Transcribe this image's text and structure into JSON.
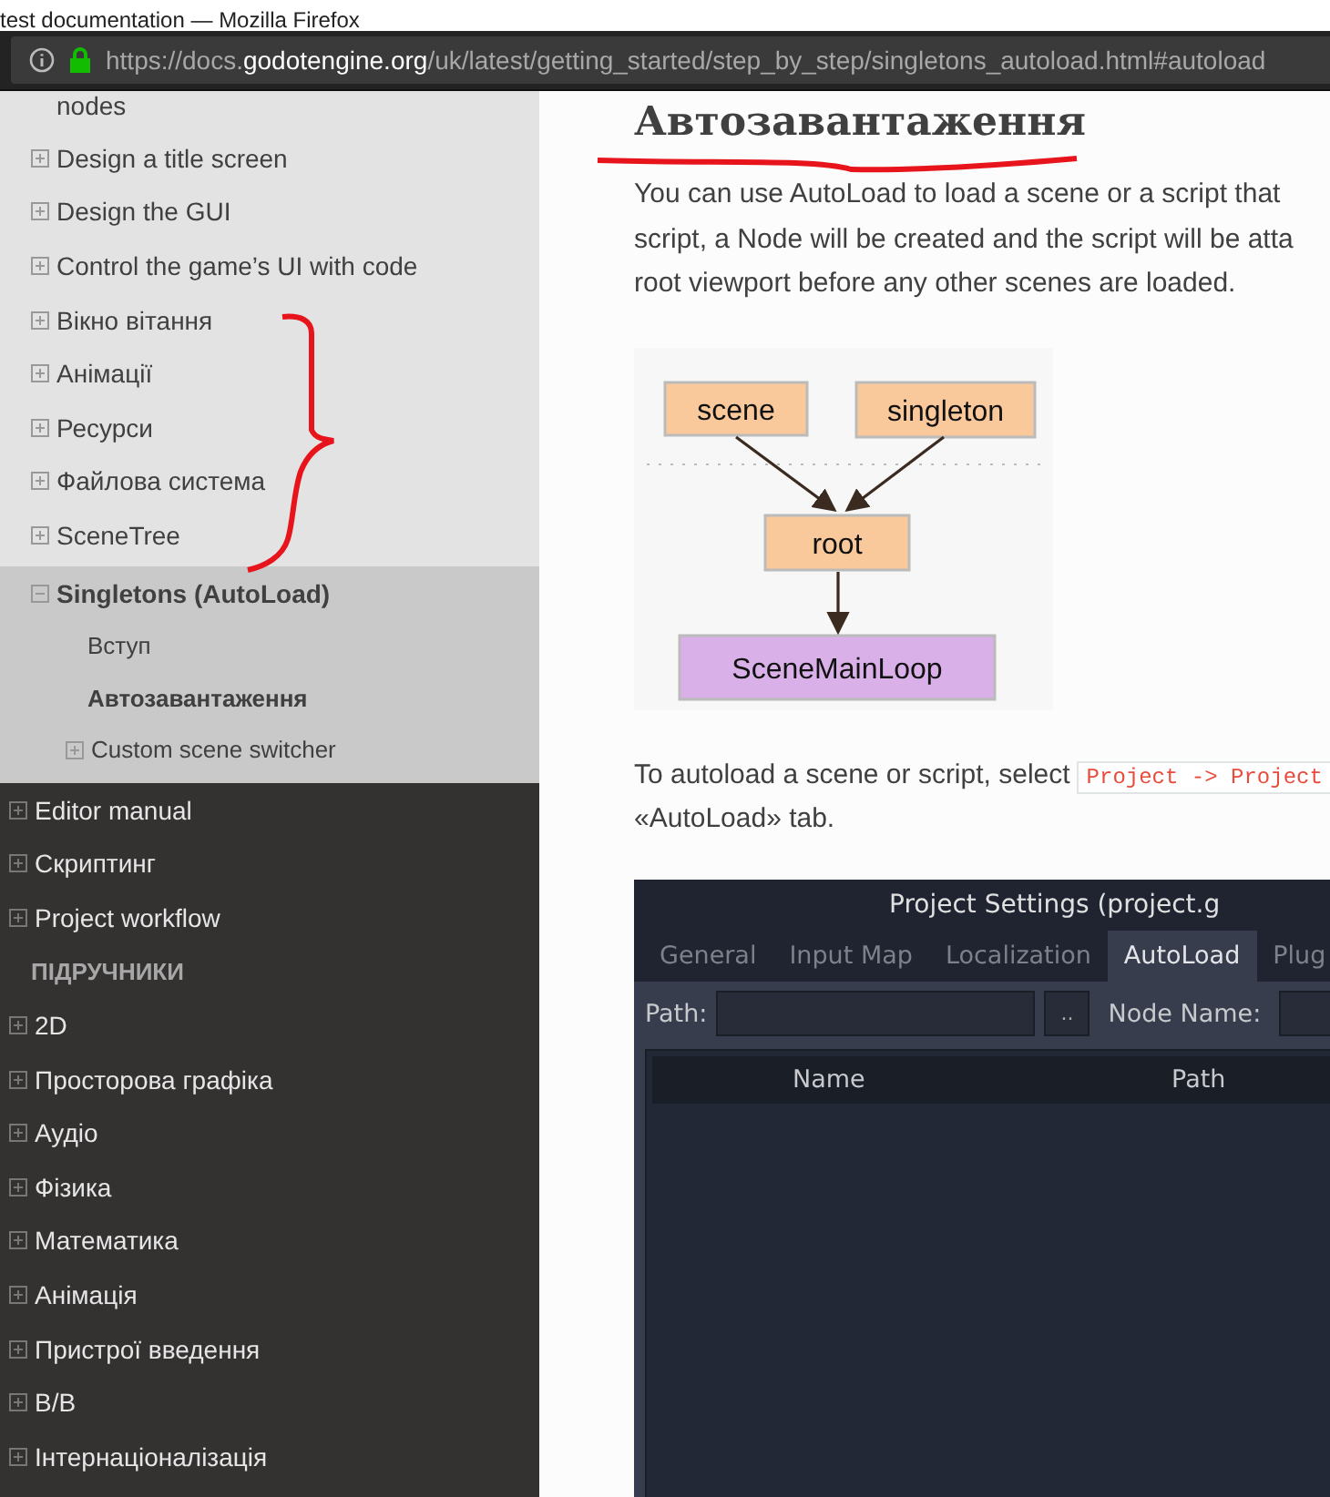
{
  "browser": {
    "window_title": "test documentation — Mozilla Firefox",
    "url": "https://docs.**godotengine.org**/uk/latest/getting_started/step_by_step/singletons_autoload.html#autoload"
  },
  "sidebar": {
    "nested_items": [
      {
        "label": "nodes",
        "kind": "continuation"
      },
      {
        "label": "Design a title screen",
        "kind": "collapsed"
      },
      {
        "label": "Design the GUI",
        "kind": "collapsed"
      },
      {
        "label": "Control the game’s UI with code",
        "kind": "collapsed"
      },
      {
        "label": "Вікно вітання",
        "kind": "collapsed"
      },
      {
        "label": "Анімації",
        "kind": "collapsed"
      },
      {
        "label": "Ресурси",
        "kind": "collapsed"
      },
      {
        "label": "Файлова система",
        "kind": "collapsed"
      },
      {
        "label": "SceneTree",
        "kind": "collapsed"
      }
    ],
    "current_item": {
      "label": "Singletons (AutoLoad)",
      "expanded": true,
      "children": [
        {
          "label": "Вступ",
          "kind": "leaf",
          "selected": false
        },
        {
          "label": "Автозавантаження",
          "kind": "leaf",
          "selected": true
        },
        {
          "label": "Custom scene switcher",
          "kind": "collapsed",
          "selected": false
        }
      ]
    },
    "items": [
      {
        "label": "Editor manual",
        "kind": "collapsed"
      },
      {
        "label": "Скриптинг",
        "kind": "collapsed"
      },
      {
        "label": "Project workflow",
        "kind": "collapsed"
      },
      {
        "label": "ПІДРУЧНИКИ",
        "kind": "caption"
      },
      {
        "label": "2D",
        "kind": "collapsed"
      },
      {
        "label": "Просторова графіка",
        "kind": "collapsed"
      },
      {
        "label": "Аудіо",
        "kind": "collapsed"
      },
      {
        "label": "Фізика",
        "kind": "collapsed"
      },
      {
        "label": "Математика",
        "kind": "collapsed"
      },
      {
        "label": "Анімація",
        "kind": "collapsed"
      },
      {
        "label": "Пристрої введення",
        "kind": "collapsed"
      },
      {
        "label": "В/В",
        "kind": "collapsed"
      },
      {
        "label": "Інтернаціоналізація",
        "kind": "collapsed"
      }
    ]
  },
  "content": {
    "heading": "Автозавантаження",
    "intro_lines": [
      "You can use AutoLoad to load a scene or a script that",
      "script, a Node will be created and the script will be atta",
      "root viewport before any other scenes are loaded."
    ],
    "diagram": {
      "nodes": [
        {
          "label": "scene",
          "color": "#f9c89b"
        },
        {
          "label": "singleton",
          "color": "#f9c89b"
        },
        {
          "label": "root",
          "color": "#f9c89b"
        },
        {
          "label": "SceneMainLoop",
          "color": "#d9b0e8"
        }
      ]
    },
    "instruction": {
      "text": "To autoload a scene or script, select",
      "code": "Project -> Project",
      "continuation": "«AutoLoad» tab."
    },
    "dialog": {
      "title": "Project Settings (project.g",
      "tabs": [
        {
          "label": "General",
          "selected": false
        },
        {
          "label": "Input Map",
          "selected": false
        },
        {
          "label": "Localization",
          "selected": false
        },
        {
          "label": "AutoLoad",
          "selected": true
        },
        {
          "label": "Plug",
          "selected": false
        }
      ],
      "path_label": "Path:",
      "browse_button": "..",
      "node_name_label": "Node Name:",
      "columns": [
        "Name",
        "Path"
      ]
    }
  }
}
